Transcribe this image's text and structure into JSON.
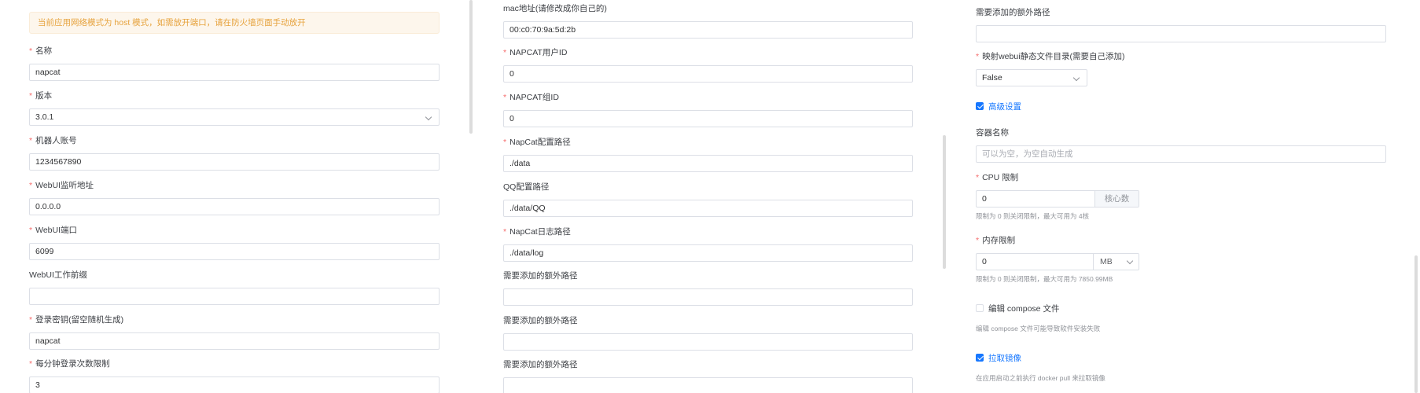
{
  "notice": "当前应用网络模式为 host 模式，如需放开端口，请在防火墙页面手动放开",
  "col1": [
    {
      "label": "名称",
      "required": true,
      "value": "napcat"
    },
    {
      "label": "版本",
      "required": true,
      "value": "3.0.1",
      "type": "select"
    },
    {
      "label": "机器人账号",
      "required": true,
      "value": "1234567890"
    },
    {
      "label": "WebUI监听地址",
      "required": true,
      "value": "0.0.0.0"
    },
    {
      "label": "WebUI端口",
      "required": true,
      "value": "6099"
    },
    {
      "label": "WebUI工作前缀",
      "required": false,
      "value": ""
    },
    {
      "label": "登录密钥(留空随机生成)",
      "required": true,
      "value": "napcat"
    },
    {
      "label": "每分钟登录次数限制",
      "required": true,
      "value": "3"
    }
  ],
  "col2": [
    {
      "label": "mac地址(请修改成你自己的)",
      "required": false,
      "value": "00:c0:70:9a:5d:2b"
    },
    {
      "label": "NAPCAT用户ID",
      "required": true,
      "value": "0"
    },
    {
      "label": "NAPCAT组ID",
      "required": true,
      "value": "0"
    },
    {
      "label": "NapCat配置路径",
      "required": true,
      "value": "./data"
    },
    {
      "label": "QQ配置路径",
      "required": false,
      "value": "./data/QQ"
    },
    {
      "label": "NapCat日志路径",
      "required": true,
      "value": "./data/log"
    },
    {
      "label": "需要添加的额外路径",
      "required": false,
      "value": ""
    },
    {
      "label": "需要添加的额外路径",
      "required": false,
      "value": ""
    },
    {
      "label": "需要添加的额外路径",
      "required": false,
      "value": ""
    }
  ],
  "col3": {
    "extra_path": {
      "label": "需要添加的额外路径",
      "value": ""
    },
    "webui_map": {
      "label": "映射webui静态文件目录(需要自己添加)",
      "value": "False"
    },
    "advanced": {
      "label": "高级设置",
      "checked": true
    },
    "container_name": {
      "label": "容器名称",
      "placeholder": "可以为空，为空自动生成"
    },
    "cpu": {
      "label": "CPU 限制",
      "value": "0",
      "unit": "核心数",
      "hint": "限制为 0 则关闭限制，最大可用为 4核"
    },
    "memory": {
      "label": "内存限制",
      "value": "0",
      "unit": "MB",
      "hint": "限制为 0 则关闭限制，最大可用为 7850.99MB"
    },
    "compose": {
      "label": "编辑 compose 文件",
      "checked": false,
      "hint": "编辑 compose 文件可能导致软件安装失败"
    },
    "pull": {
      "label": "拉取镜像",
      "checked": true,
      "hint": "在应用启动之前执行 docker pull 来拉取镜像"
    }
  },
  "colors": {
    "accent": "#1677ff",
    "required": "#f56c6c",
    "warning": "#e6a23c"
  }
}
